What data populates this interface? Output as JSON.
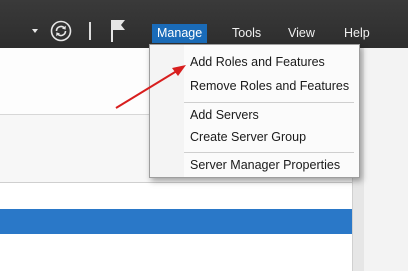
{
  "toolbar": {
    "icons": [
      "dropdown-arrow-icon",
      "refresh-icon",
      "flag-icon"
    ],
    "menus": [
      {
        "label": "Manage"
      },
      {
        "label": "Tools"
      },
      {
        "label": "View"
      },
      {
        "label": "Help"
      }
    ]
  },
  "manage_menu": {
    "items": [
      "Add Roles and Features",
      "Remove Roles and Features",
      "Add Servers",
      "Create Server Group",
      "Server Manager Properties"
    ]
  },
  "colors": {
    "toolbar_bg": "#2d2d2d",
    "menu_active": "#1a6bb8",
    "selected_row": "#2a78c8",
    "annotation_arrow": "#d81e1e"
  }
}
